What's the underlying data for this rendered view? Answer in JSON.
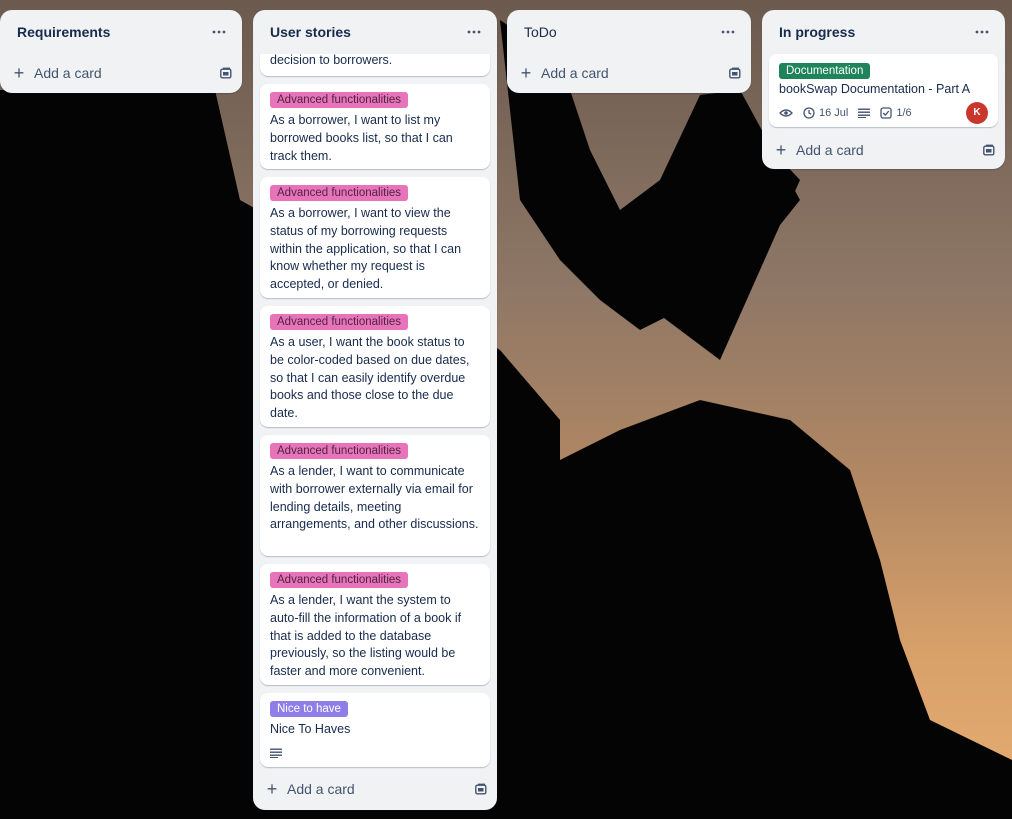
{
  "theme": {
    "pink_label": "#e774bb",
    "pink_text": "#50253f",
    "purple_label": "#8f7ee7",
    "green_label": "#1f845a"
  },
  "lists": {
    "requirements": {
      "title": "Requirements",
      "add_label": "Add a card"
    },
    "user_stories": {
      "title": "User stories",
      "add_label": "Add a card",
      "partial_card_text": "decision to borrowers.",
      "cards": [
        {
          "label": "Advanced functionalities",
          "text": "As a borrower, I want to list my borrowed books list, so that I can track them."
        },
        {
          "label": "Advanced functionalities",
          "text": "As a borrower, I want to view the status of my borrowing requests within the application, so that I can know whether my request is accepted, or denied."
        },
        {
          "label": "Advanced functionalities",
          "text": "As a user, I want the book status to be color-coded based on due dates, so that I can easily identify overdue books and those close to the due date."
        },
        {
          "label": "Advanced functionalities",
          "text": "As a lender, I want to communicate with borrower externally via email for lending details, meeting arrangements, and other discussions."
        },
        {
          "label": "Advanced functionalities",
          "text": "As a lender, I want the system to auto-fill the information of a book if that is added to the database previously, so the listing would be faster and more convenient."
        },
        {
          "label": "Nice to have",
          "text": "Nice To Haves"
        }
      ]
    },
    "todo": {
      "title": "ToDo",
      "add_label": "Add a card"
    },
    "in_progress": {
      "title": "In progress",
      "add_label": "Add a card",
      "card": {
        "label": "Documentation",
        "title": "bookSwap Documentation - Part A",
        "due": "16 Jul",
        "checklist": "1/6",
        "avatar": "K"
      }
    }
  }
}
